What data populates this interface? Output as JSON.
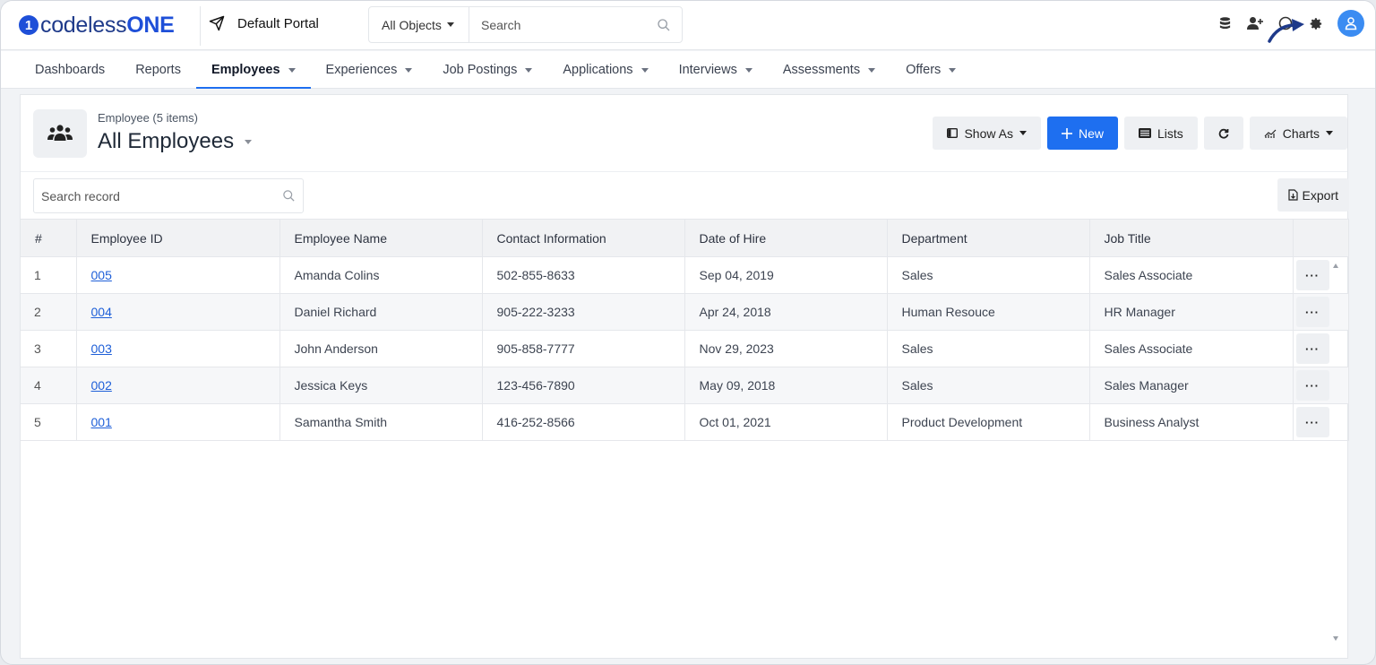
{
  "app": {
    "logo_mark": "1",
    "logo_text_a": "codeless",
    "logo_text_b": "ONE"
  },
  "header": {
    "portal_name": "Default Portal",
    "object_select": "All Objects",
    "search_placeholder": "Search",
    "icons": [
      "database-icon",
      "add-user-icon",
      "help-icon",
      "gear-icon",
      "user-avatar-icon"
    ]
  },
  "nav": {
    "items": [
      {
        "label": "Dashboards",
        "dropdown": false
      },
      {
        "label": "Reports",
        "dropdown": false
      },
      {
        "label": "Employees",
        "dropdown": true,
        "active": true
      },
      {
        "label": "Experiences",
        "dropdown": true
      },
      {
        "label": "Job Postings",
        "dropdown": true
      },
      {
        "label": "Applications",
        "dropdown": true
      },
      {
        "label": "Interviews",
        "dropdown": true
      },
      {
        "label": "Assessments",
        "dropdown": true
      },
      {
        "label": "Offers",
        "dropdown": true
      }
    ]
  },
  "list": {
    "subtitle": "Employee (5 items)",
    "title": "All Employees",
    "toolbar": {
      "show_as": "Show As",
      "new": "New",
      "lists": "Lists",
      "charts": "Charts"
    },
    "search_placeholder": "Search record",
    "export": "Export"
  },
  "table": {
    "columns": [
      "#",
      "Employee ID",
      "Employee Name",
      "Contact Information",
      "Date of Hire",
      "Department",
      "Job Title"
    ],
    "rows": [
      {
        "num": "1",
        "id": "005",
        "name": "Amanda Colins",
        "contact": "502-855-8633",
        "hire": "Sep 04, 2019",
        "dept": "Sales",
        "title": "Sales Associate"
      },
      {
        "num": "2",
        "id": "004",
        "name": "Daniel Richard",
        "contact": "905-222-3233",
        "hire": "Apr 24, 2018",
        "dept": "Human Resouce",
        "title": "HR Manager"
      },
      {
        "num": "3",
        "id": "003",
        "name": "John Anderson",
        "contact": "905-858-7777",
        "hire": "Nov 29, 2023",
        "dept": "Sales",
        "title": "Sales Associate"
      },
      {
        "num": "4",
        "id": "002",
        "name": "Jessica Keys",
        "contact": "123-456-7890",
        "hire": "May 09, 2018",
        "dept": "Sales",
        "title": "Sales Manager"
      },
      {
        "num": "5",
        "id": "001",
        "name": "Samantha Smith",
        "contact": "416-252-8566",
        "hire": "Oct 01, 2021",
        "dept": "Product Development",
        "title": "Business Analyst"
      }
    ],
    "row_menu": "···"
  },
  "colors": {
    "brand": "#1e4fd8",
    "primary_button": "#1e6ff0",
    "link": "#1e5fd8"
  }
}
